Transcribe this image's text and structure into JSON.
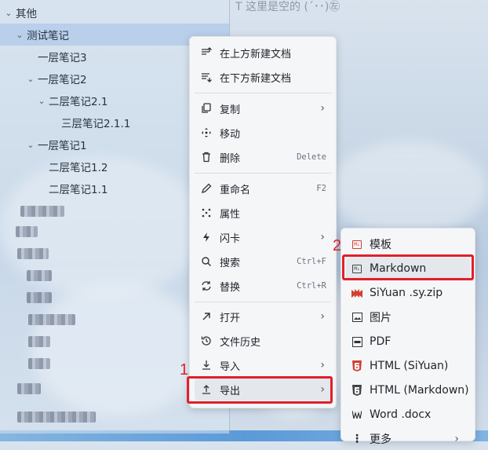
{
  "editor": {
    "hint": "T 这里是空的 (´･･)㊧"
  },
  "sidebar": {
    "items": [
      {
        "label": "其他",
        "chevron": "⌄"
      },
      {
        "label": "测试笔记",
        "chevron": "⌄"
      },
      {
        "label": "一层笔记3",
        "chevron": ""
      },
      {
        "label": "一层笔记2",
        "chevron": "⌄"
      },
      {
        "label": "二层笔记2.1",
        "chevron": "⌄"
      },
      {
        "label": "三层笔记2.1.1",
        "chevron": ""
      },
      {
        "label": "一层笔记1",
        "chevron": "⌄"
      },
      {
        "label": "二层笔记1.2",
        "chevron": ""
      },
      {
        "label": "二层笔记1.1",
        "chevron": ""
      }
    ]
  },
  "context_menu": {
    "items": [
      {
        "label": "在上方新建文档",
        "icon": "insert-above-icon",
        "hint": "",
        "arrow": ""
      },
      {
        "label": "在下方新建文档",
        "icon": "insert-below-icon",
        "hint": "",
        "arrow": ""
      },
      {
        "label": "复制",
        "icon": "copy-icon",
        "hint": "",
        "arrow": "›"
      },
      {
        "label": "移动",
        "icon": "move-icon",
        "hint": "",
        "arrow": ""
      },
      {
        "label": "删除",
        "icon": "trash-icon",
        "hint": "Delete",
        "arrow": ""
      },
      {
        "label": "重命名",
        "icon": "pencil-icon",
        "hint": "F2",
        "arrow": ""
      },
      {
        "label": "属性",
        "icon": "attributes-icon",
        "hint": "",
        "arrow": ""
      },
      {
        "label": "闪卡",
        "icon": "flash-icon",
        "hint": "",
        "arrow": "›"
      },
      {
        "label": "搜索",
        "icon": "search-icon",
        "hint": "Ctrl+F",
        "arrow": ""
      },
      {
        "label": "替换",
        "icon": "replace-icon",
        "hint": "Ctrl+R",
        "arrow": ""
      },
      {
        "label": "打开",
        "icon": "open-icon",
        "hint": "",
        "arrow": "›"
      },
      {
        "label": "文件历史",
        "icon": "history-icon",
        "hint": "",
        "arrow": ""
      },
      {
        "label": "导入",
        "icon": "import-icon",
        "hint": "",
        "arrow": "›"
      },
      {
        "label": "导出",
        "icon": "export-icon",
        "hint": "",
        "arrow": "›"
      }
    ]
  },
  "export_submenu": {
    "items": [
      {
        "label": "模板",
        "icon": "template-icon"
      },
      {
        "label": "Markdown",
        "icon": "markdown-icon"
      },
      {
        "label": "SiYuan .sy.zip",
        "icon": "siyuan-icon"
      },
      {
        "label": "图片",
        "icon": "image-icon"
      },
      {
        "label": "PDF",
        "icon": "pdf-icon"
      },
      {
        "label": "HTML (SiYuan)",
        "icon": "html5-icon"
      },
      {
        "label": "HTML (Markdown)",
        "icon": "html5-icon"
      },
      {
        "label": "Word .docx",
        "icon": "word-icon"
      },
      {
        "label": "更多",
        "icon": "more-icon"
      }
    ]
  },
  "badges": {
    "md": "M↓"
  },
  "annotations": {
    "step1": "1",
    "step2": "2"
  },
  "colors": {
    "highlight": "#e0202a",
    "accent": "#d23f31"
  }
}
